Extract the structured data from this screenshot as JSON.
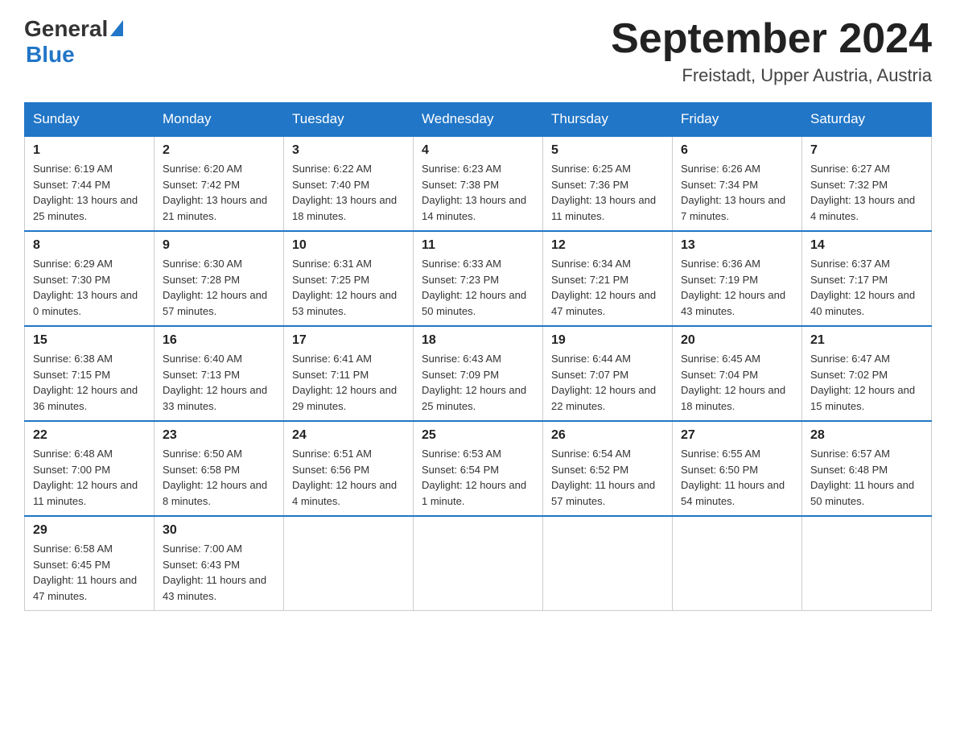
{
  "header": {
    "logo_general": "General",
    "logo_blue": "Blue",
    "month_title": "September 2024",
    "location": "Freistadt, Upper Austria, Austria"
  },
  "days_of_week": [
    "Sunday",
    "Monday",
    "Tuesday",
    "Wednesday",
    "Thursday",
    "Friday",
    "Saturday"
  ],
  "weeks": [
    [
      {
        "day": "1",
        "sunrise": "6:19 AM",
        "sunset": "7:44 PM",
        "daylight": "13 hours and 25 minutes."
      },
      {
        "day": "2",
        "sunrise": "6:20 AM",
        "sunset": "7:42 PM",
        "daylight": "13 hours and 21 minutes."
      },
      {
        "day": "3",
        "sunrise": "6:22 AM",
        "sunset": "7:40 PM",
        "daylight": "13 hours and 18 minutes."
      },
      {
        "day": "4",
        "sunrise": "6:23 AM",
        "sunset": "7:38 PM",
        "daylight": "13 hours and 14 minutes."
      },
      {
        "day": "5",
        "sunrise": "6:25 AM",
        "sunset": "7:36 PM",
        "daylight": "13 hours and 11 minutes."
      },
      {
        "day": "6",
        "sunrise": "6:26 AM",
        "sunset": "7:34 PM",
        "daylight": "13 hours and 7 minutes."
      },
      {
        "day": "7",
        "sunrise": "6:27 AM",
        "sunset": "7:32 PM",
        "daylight": "13 hours and 4 minutes."
      }
    ],
    [
      {
        "day": "8",
        "sunrise": "6:29 AM",
        "sunset": "7:30 PM",
        "daylight": "13 hours and 0 minutes."
      },
      {
        "day": "9",
        "sunrise": "6:30 AM",
        "sunset": "7:28 PM",
        "daylight": "12 hours and 57 minutes."
      },
      {
        "day": "10",
        "sunrise": "6:31 AM",
        "sunset": "7:25 PM",
        "daylight": "12 hours and 53 minutes."
      },
      {
        "day": "11",
        "sunrise": "6:33 AM",
        "sunset": "7:23 PM",
        "daylight": "12 hours and 50 minutes."
      },
      {
        "day": "12",
        "sunrise": "6:34 AM",
        "sunset": "7:21 PM",
        "daylight": "12 hours and 47 minutes."
      },
      {
        "day": "13",
        "sunrise": "6:36 AM",
        "sunset": "7:19 PM",
        "daylight": "12 hours and 43 minutes."
      },
      {
        "day": "14",
        "sunrise": "6:37 AM",
        "sunset": "7:17 PM",
        "daylight": "12 hours and 40 minutes."
      }
    ],
    [
      {
        "day": "15",
        "sunrise": "6:38 AM",
        "sunset": "7:15 PM",
        "daylight": "12 hours and 36 minutes."
      },
      {
        "day": "16",
        "sunrise": "6:40 AM",
        "sunset": "7:13 PM",
        "daylight": "12 hours and 33 minutes."
      },
      {
        "day": "17",
        "sunrise": "6:41 AM",
        "sunset": "7:11 PM",
        "daylight": "12 hours and 29 minutes."
      },
      {
        "day": "18",
        "sunrise": "6:43 AM",
        "sunset": "7:09 PM",
        "daylight": "12 hours and 25 minutes."
      },
      {
        "day": "19",
        "sunrise": "6:44 AM",
        "sunset": "7:07 PM",
        "daylight": "12 hours and 22 minutes."
      },
      {
        "day": "20",
        "sunrise": "6:45 AM",
        "sunset": "7:04 PM",
        "daylight": "12 hours and 18 minutes."
      },
      {
        "day": "21",
        "sunrise": "6:47 AM",
        "sunset": "7:02 PM",
        "daylight": "12 hours and 15 minutes."
      }
    ],
    [
      {
        "day": "22",
        "sunrise": "6:48 AM",
        "sunset": "7:00 PM",
        "daylight": "12 hours and 11 minutes."
      },
      {
        "day": "23",
        "sunrise": "6:50 AM",
        "sunset": "6:58 PM",
        "daylight": "12 hours and 8 minutes."
      },
      {
        "day": "24",
        "sunrise": "6:51 AM",
        "sunset": "6:56 PM",
        "daylight": "12 hours and 4 minutes."
      },
      {
        "day": "25",
        "sunrise": "6:53 AM",
        "sunset": "6:54 PM",
        "daylight": "12 hours and 1 minute."
      },
      {
        "day": "26",
        "sunrise": "6:54 AM",
        "sunset": "6:52 PM",
        "daylight": "11 hours and 57 minutes."
      },
      {
        "day": "27",
        "sunrise": "6:55 AM",
        "sunset": "6:50 PM",
        "daylight": "11 hours and 54 minutes."
      },
      {
        "day": "28",
        "sunrise": "6:57 AM",
        "sunset": "6:48 PM",
        "daylight": "11 hours and 50 minutes."
      }
    ],
    [
      {
        "day": "29",
        "sunrise": "6:58 AM",
        "sunset": "6:45 PM",
        "daylight": "11 hours and 47 minutes."
      },
      {
        "day": "30",
        "sunrise": "7:00 AM",
        "sunset": "6:43 PM",
        "daylight": "11 hours and 43 minutes."
      },
      null,
      null,
      null,
      null,
      null
    ]
  ],
  "labels": {
    "sunrise": "Sunrise:",
    "sunset": "Sunset:",
    "daylight": "Daylight:"
  }
}
